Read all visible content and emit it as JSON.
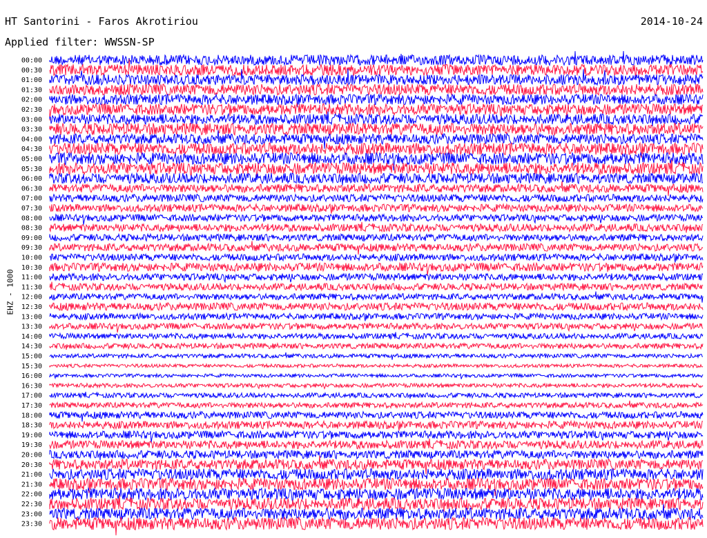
{
  "header": {
    "station": "HT Santorini - Faros Akrotiriou",
    "date": "2014-10-24",
    "filter": "Applied filter: WWSSN-SP",
    "channel": "EHZ - 1000"
  },
  "colors": {
    "trace_a": "#0000ff",
    "trace_b": "#ff1744",
    "background": "#ffffff",
    "text": "#000000"
  },
  "chart_data": {
    "type": "line",
    "title": "HT Santorini - Faros Akrotiriou",
    "subtitle": "Applied filter: WWSSN-SP",
    "ylabel": "EHZ - 1000",
    "x_span_minutes": 30,
    "trace_color_cycle": [
      "#0000ff",
      "#ff1744"
    ],
    "rows": [
      {
        "label": "00:00",
        "amplitude": 0.75
      },
      {
        "label": "00:30",
        "amplitude": 0.8
      },
      {
        "label": "01:00",
        "amplitude": 0.75
      },
      {
        "label": "01:30",
        "amplitude": 0.8
      },
      {
        "label": "02:00",
        "amplitude": 0.75
      },
      {
        "label": "02:30",
        "amplitude": 0.8
      },
      {
        "label": "03:00",
        "amplitude": 0.75
      },
      {
        "label": "03:30",
        "amplitude": 0.85
      },
      {
        "label": "04:00",
        "amplitude": 0.75
      },
      {
        "label": "04:30",
        "amplitude": 0.85
      },
      {
        "label": "05:00",
        "amplitude": 0.85
      },
      {
        "label": "05:30",
        "amplitude": 0.85
      },
      {
        "label": "06:00",
        "amplitude": 0.75
      },
      {
        "label": "06:30",
        "amplitude": 0.6
      },
      {
        "label": "07:00",
        "amplitude": 0.55
      },
      {
        "label": "07:30",
        "amplitude": 0.55
      },
      {
        "label": "08:00",
        "amplitude": 0.5
      },
      {
        "label": "08:30",
        "amplitude": 0.55
      },
      {
        "label": "09:00",
        "amplitude": 0.5
      },
      {
        "label": "09:30",
        "amplitude": 0.55
      },
      {
        "label": "10:00",
        "amplitude": 0.5
      },
      {
        "label": "10:30",
        "amplitude": 0.6
      },
      {
        "label": "11:00",
        "amplitude": 0.5
      },
      {
        "label": "11:30",
        "amplitude": 0.5
      },
      {
        "label": "12:00",
        "amplitude": 0.45
      },
      {
        "label": "12:30",
        "amplitude": 0.55
      },
      {
        "label": "13:00",
        "amplitude": 0.45
      },
      {
        "label": "13:30",
        "amplitude": 0.45
      },
      {
        "label": "14:00",
        "amplitude": 0.4
      },
      {
        "label": "14:30",
        "amplitude": 0.4
      },
      {
        "label": "15:00",
        "amplitude": 0.3
      },
      {
        "label": "15:30",
        "amplitude": 0.25
      },
      {
        "label": "16:00",
        "amplitude": 0.25
      },
      {
        "label": "16:30",
        "amplitude": 0.3
      },
      {
        "label": "17:00",
        "amplitude": 0.35
      },
      {
        "label": "17:30",
        "amplitude": 0.4
      },
      {
        "label": "18:00",
        "amplitude": 0.5
      },
      {
        "label": "18:30",
        "amplitude": 0.55
      },
      {
        "label": "19:00",
        "amplitude": 0.55
      },
      {
        "label": "19:30",
        "amplitude": 0.6
      },
      {
        "label": "20:00",
        "amplitude": 0.6
      },
      {
        "label": "20:30",
        "amplitude": 0.75
      },
      {
        "label": "21:00",
        "amplitude": 0.8
      },
      {
        "label": "21:30",
        "amplitude": 0.85
      },
      {
        "label": "22:00",
        "amplitude": 0.85
      },
      {
        "label": "22:30",
        "amplitude": 0.85
      },
      {
        "label": "23:00",
        "amplitude": 0.85
      },
      {
        "label": "23:30",
        "amplitude": 0.9
      }
    ],
    "grid": false,
    "legend": "none"
  }
}
